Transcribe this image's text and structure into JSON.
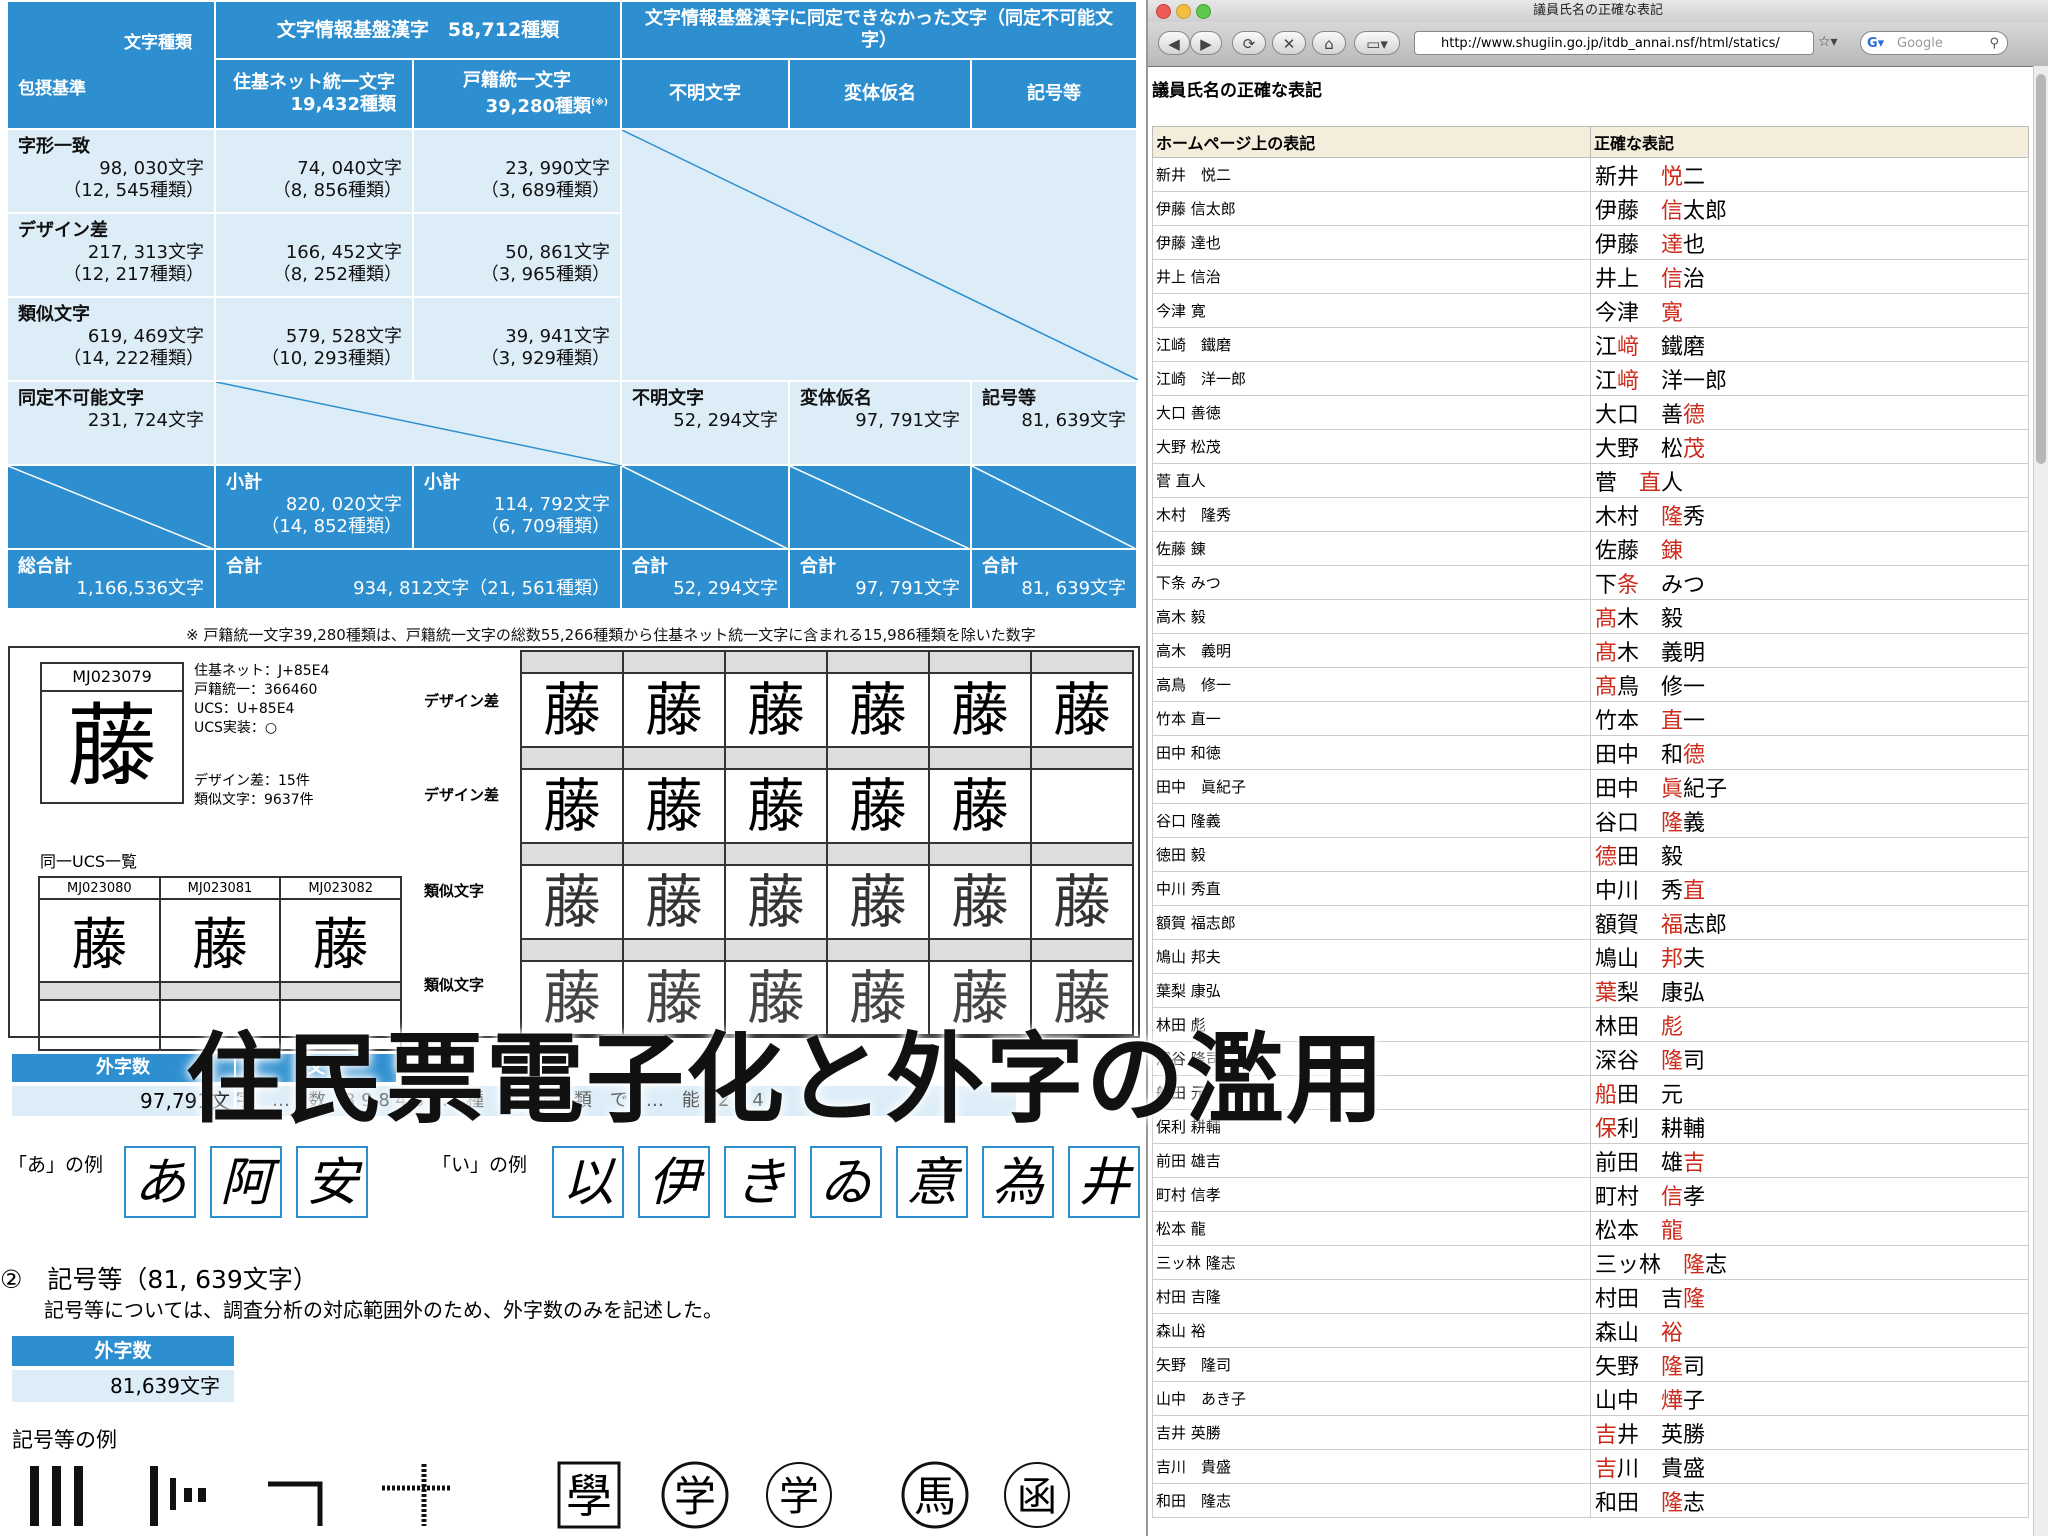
{
  "stats_table": {
    "corner_top": "文字種類",
    "corner_bottom": "包摂基準",
    "col_group1": "文字情報基盤漢字　58,712種類",
    "col_group2": "文字情報基盤漢字に同定できなかった文字（同定不可能文字）",
    "col_juki": "住基ネット統一文字",
    "col_juki_count": "19,432種類",
    "col_koseki": "戸籍統一文字",
    "col_koseki_count": "39,280種類",
    "col_koseki_note": "(※)",
    "col_unknown": "不明文字",
    "col_hentai": "変体仮名",
    "col_kigou": "記号等",
    "rows": [
      {
        "label": "字形一致",
        "total": "98, 030文字",
        "total_kinds": "（12, 545種類）",
        "juki": "74, 040文字",
        "juki_kinds": "（8, 856種類）",
        "koseki": "23, 990文字",
        "koseki_kinds": "（3, 689種類）"
      },
      {
        "label": "デザイン差",
        "total": "217, 313文字",
        "total_kinds": "（12, 217種類）",
        "juki": "166, 452文字",
        "juki_kinds": "（8, 252種類）",
        "koseki": "50, 861文字",
        "koseki_kinds": "（3, 965種類）"
      },
      {
        "label": "類似文字",
        "total": "619, 469文字",
        "total_kinds": "（14, 222種類）",
        "juki": "579, 528文字",
        "juki_kinds": "（10, 293種類）",
        "koseki": "39, 941文字",
        "koseki_kinds": "（3, 929種類）"
      }
    ],
    "unident": {
      "label": "同定不可能文字",
      "total": "231, 724文字",
      "unknown_label": "不明文字",
      "unknown": "52, 294文字",
      "hentai_label": "変体仮名",
      "hentai": "97, 791文字",
      "kigou_label": "記号等",
      "kigou": "81, 639文字"
    },
    "subtotal": {
      "label": "小計",
      "juki": "820, 020文字",
      "juki_kinds": "（14, 852種類）",
      "koseki": "114, 792文字",
      "koseki_kinds": "（6, 709種類）"
    },
    "grand": {
      "label": "総合計",
      "value": "1,166,536文字",
      "sum_label": "合計",
      "sum": "934, 812文字（21, 561種類）",
      "unknown": "52, 294文字",
      "hentai": "97, 791文字",
      "kigou": "81, 639文字"
    }
  },
  "footnote": "※ 戸籍統一文字39,280種類は、戸籍統一文字の総数55,266種類から住基ネット統一文字に含まれる15,986種類を除いた数字",
  "sample": {
    "code": "MJ023079",
    "glyph": "藤",
    "info": "住基ネット：J+85E4\n戸籍統一：366460\nUCS：U+85E4\nUCS実装：○",
    "info2": "デザイン差：15件\n類似文字：9637件",
    "same_ucs_label": "同一UCS一覧",
    "ucs_codes": [
      "MJ023080",
      "MJ023081",
      "MJ023082"
    ],
    "row_labels": [
      "デザイン差",
      "デザイン差",
      "類似文字",
      "類似文字"
    ]
  },
  "overlay_title": "住民票電子化と外字の濫用",
  "gaiji_block": {
    "head": "外字数",
    "head2": "文",
    "value": "97,791文",
    "line": "字　…　数　3 9 8 4 6 …　種　類　分　類　で　…　能　2 9 4 3"
  },
  "examples": {
    "a_label": "「あ」の例",
    "i_label": "「い」の例",
    "a_glyphs": [
      "あ",
      "阿",
      "安"
    ],
    "i_glyphs": [
      "以",
      "伊",
      "き",
      "ゐ",
      "意",
      "為",
      "井"
    ]
  },
  "section2": {
    "title": "②　記号等（81, 639文字）",
    "desc": "記号等については、調査分析の対応範囲外のため、外字数のみを記述した。",
    "head": "外字数",
    "value": "81,639文字",
    "symbols_label": "記号等の例"
  },
  "browser": {
    "window_title": "議員氏名の正確な表記",
    "url": "http://www.shugiin.go.jp/itdb_annai.nsf/html/statics/",
    "search_placeholder": "Google",
    "page_heading": "議員氏名の正確な表記",
    "col_homepage": "ホームページ上の表記",
    "col_correct": "正確な表記",
    "rows": [
      {
        "hp": "新井　悦二",
        "a": "新井　",
        "h": "悦",
        "b": "二"
      },
      {
        "hp": "伊藤 信太郎",
        "a": "伊藤　",
        "h": "信",
        "b": "太郎"
      },
      {
        "hp": "伊藤 達也",
        "a": "伊藤　",
        "h": "達",
        "b": "也"
      },
      {
        "hp": "井上 信治",
        "a": "井上　",
        "h": "信",
        "b": "治"
      },
      {
        "hp": "今津 寛",
        "a": "今津　",
        "h": "寛",
        "b": ""
      },
      {
        "hp": "江崎　鐵磨",
        "a": "江",
        "h": "﨑",
        "b": "　鐵磨"
      },
      {
        "hp": "江崎　洋一郎",
        "a": "江",
        "h": "﨑",
        "b": "　洋一郎"
      },
      {
        "hp": "大口 善徳",
        "a": "大口　善",
        "h": "德",
        "b": ""
      },
      {
        "hp": "大野 松茂",
        "a": "大野　松",
        "h": "茂",
        "b": ""
      },
      {
        "hp": "菅 直人",
        "a": "菅　",
        "h": "直",
        "b": "人"
      },
      {
        "hp": "木村　隆秀",
        "a": "木村　",
        "h": "隆",
        "b": "秀"
      },
      {
        "hp": "佐藤 錬",
        "a": "佐藤　",
        "h": "錬",
        "b": ""
      },
      {
        "hp": "下条 みつ",
        "a": "下",
        "h": "条",
        "b": "　みつ"
      },
      {
        "hp": "高木 毅",
        "a": "",
        "h": "髙",
        "b": "木　毅"
      },
      {
        "hp": "高木　義明",
        "a": "",
        "h": "髙",
        "b": "木　義明"
      },
      {
        "hp": "高鳥　修一",
        "a": "",
        "h": "髙",
        "b": "鳥　修一"
      },
      {
        "hp": "竹本 直一",
        "a": "竹本　",
        "h": "直",
        "b": "一"
      },
      {
        "hp": "田中 和徳",
        "a": "田中　和",
        "h": "德",
        "b": ""
      },
      {
        "hp": "田中　眞紀子",
        "a": "田中　",
        "h": "眞",
        "b": "紀子"
      },
      {
        "hp": "谷口 隆義",
        "a": "谷口　",
        "h": "隆",
        "b": "義"
      },
      {
        "hp": "徳田 毅",
        "a": "",
        "h": "德",
        "b": "田　毅"
      },
      {
        "hp": "中川 秀直",
        "a": "中川　秀",
        "h": "直",
        "b": ""
      },
      {
        "hp": "額賀 福志郎",
        "a": "額賀　",
        "h": "福",
        "b": "志郎"
      },
      {
        "hp": "鳩山 邦夫",
        "a": "鳩山　",
        "h": "邦",
        "b": "夫"
      },
      {
        "hp": "葉梨 康弘",
        "a": "",
        "h": "葉",
        "b": "梨　康弘"
      },
      {
        "hp": "林田 彪",
        "a": "林田　",
        "h": "彪",
        "b": ""
      },
      {
        "hp": "深谷 隆司",
        "a": "深谷　",
        "h": "隆",
        "b": "司"
      },
      {
        "hp": "船田 元",
        "a": "",
        "h": "船",
        "b": "田　元"
      },
      {
        "hp": "保利 耕輔",
        "a": "",
        "h": "保",
        "b": "利　耕輔"
      },
      {
        "hp": "前田 雄吉",
        "a": "前田　雄",
        "h": "吉",
        "b": ""
      },
      {
        "hp": "町村 信孝",
        "a": "町村　",
        "h": "信",
        "b": "孝"
      },
      {
        "hp": "松本 龍",
        "a": "松本　",
        "h": "龍",
        "b": ""
      },
      {
        "hp": "三ッ林 隆志",
        "a": "三ッ林　",
        "h": "隆",
        "b": "志"
      },
      {
        "hp": "村田 吉隆",
        "a": "村田　吉",
        "h": "隆",
        "b": ""
      },
      {
        "hp": "森山 裕",
        "a": "森山　",
        "h": "裕",
        "b": ""
      },
      {
        "hp": "矢野　隆司",
        "a": "矢野　",
        "h": "隆",
        "b": "司"
      },
      {
        "hp": "山中　あき子",
        "a": "山中　",
        "h": "燁",
        "b": "子"
      },
      {
        "hp": "吉井 英勝",
        "a": "",
        "h": "吉",
        "b": "井　英勝"
      },
      {
        "hp": "吉川　貴盛",
        "a": "",
        "h": "吉",
        "b": "川　貴盛"
      },
      {
        "hp": "和田　隆志",
        "a": "和田　",
        "h": "隆",
        "b": "志"
      }
    ]
  },
  "colors": {
    "table_blue": "#2d8fd0",
    "table_light": "#dcedf8",
    "highlight_red": "#cc2a1a",
    "header_beige": "#f4eddc"
  }
}
